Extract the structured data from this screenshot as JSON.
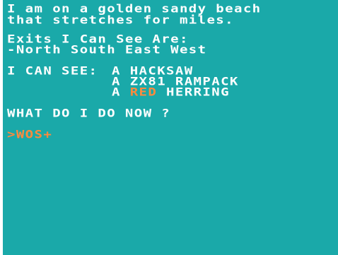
{
  "description": {
    "line1": "I am on a golden sandy beach",
    "line2": "that stretches for miles."
  },
  "exits": {
    "heading": "Exits I Can See Are:",
    "list": "-North South East West"
  },
  "inventory": {
    "heading": "I CAN SEE:",
    "items": [
      {
        "article": "A ",
        "highlight": "",
        "rest": "HACKSAW"
      },
      {
        "article": "A ",
        "highlight": "",
        "rest": "ZX81 RAMPACK"
      },
      {
        "article": "A ",
        "highlight": "RED",
        "rest": " HERRING"
      }
    ]
  },
  "question": "WHAT DO I DO NOW ?",
  "command": {
    "marker": ">",
    "text": "WOS+"
  },
  "colors": {
    "background": "#1aa9a9",
    "text": "#ffffff",
    "highlight": "#ff8a3d"
  }
}
